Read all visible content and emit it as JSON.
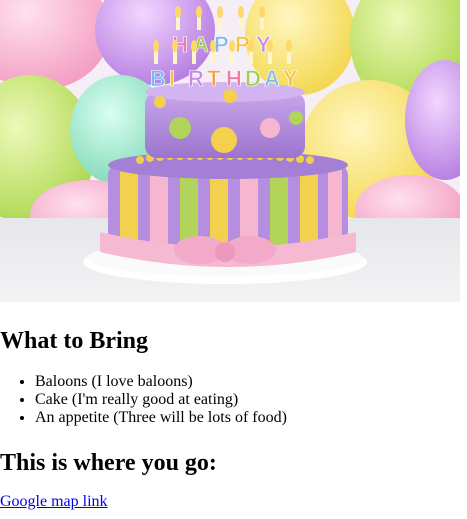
{
  "hero": {
    "candle_letters": [
      "H",
      "A",
      "P",
      "P",
      "Y",
      "B",
      "I",
      "R",
      "T",
      "H",
      "D",
      "A",
      "Y"
    ],
    "icon": "birthday-cake-photo"
  },
  "bring": {
    "heading": "What to Bring",
    "items": [
      "Baloons (I love baloons)",
      "Cake (I'm really good at eating)",
      "An appetite (Three will be lots of food)"
    ]
  },
  "directions": {
    "heading": "This is where you go:",
    "link_text": "Google map link"
  },
  "colors": {
    "link": "#0000ee",
    "background": "#ffffff"
  }
}
